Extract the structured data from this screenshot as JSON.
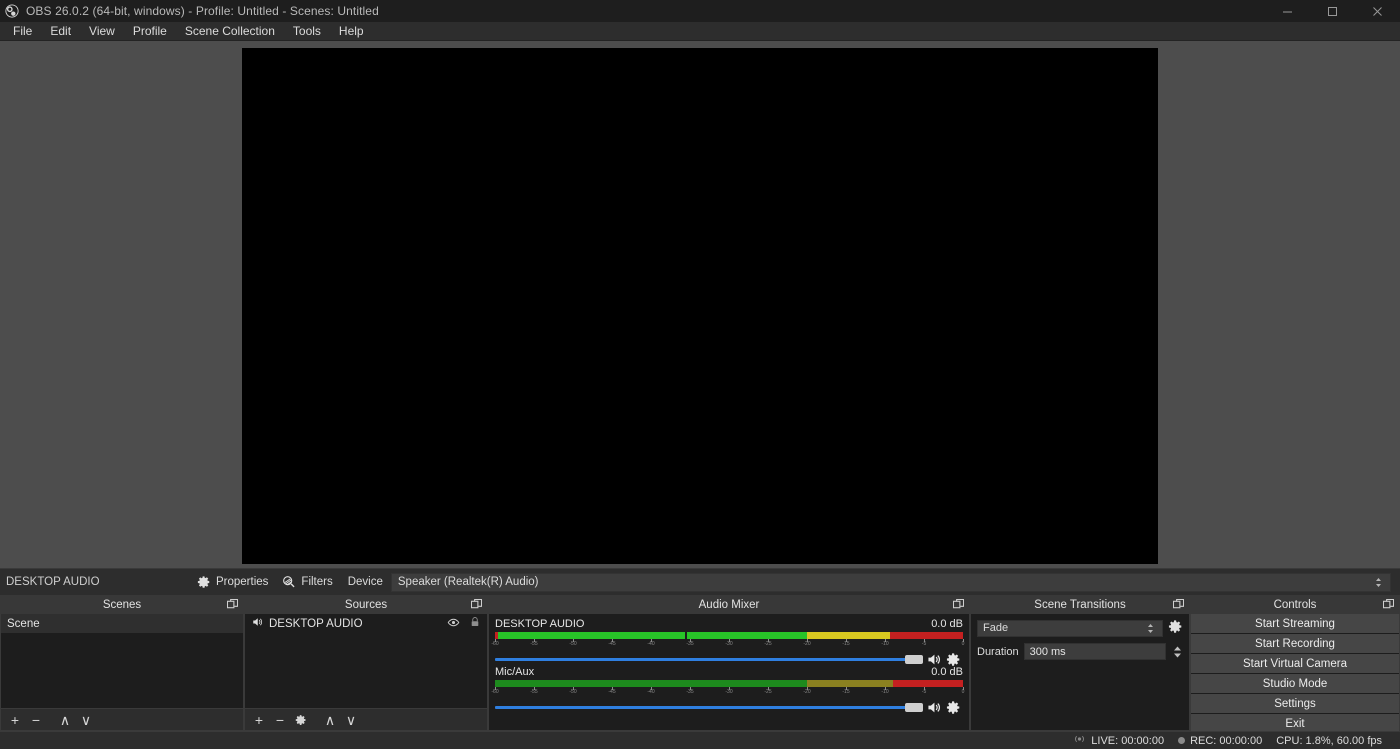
{
  "window": {
    "title": "OBS 26.0.2 (64-bit, windows) - Profile: Untitled - Scenes: Untitled",
    "minimize_label": "Minimize",
    "maximize_label": "Maximize",
    "close_label": "Close"
  },
  "menu": {
    "items": [
      {
        "label": "File"
      },
      {
        "label": "Edit"
      },
      {
        "label": "View"
      },
      {
        "label": "Profile"
      },
      {
        "label": "Scene Collection"
      },
      {
        "label": "Tools"
      },
      {
        "label": "Help"
      }
    ]
  },
  "source_toolbar": {
    "selected_source": "DESKTOP AUDIO",
    "properties_label": "Properties",
    "filters_label": "Filters",
    "device_label": "Device",
    "device_value": "Speaker (Realtek(R) Audio)"
  },
  "scenes": {
    "title": "Scenes",
    "items": [
      {
        "label": "Scene",
        "selected": true
      }
    ],
    "toolbar": [
      {
        "name": "add-scene-button",
        "glyph": "+"
      },
      {
        "name": "remove-scene-button",
        "glyph": "−"
      },
      {
        "name": "move-scene-up-button",
        "glyph": "∧"
      },
      {
        "name": "move-scene-down-button",
        "glyph": "∨"
      }
    ]
  },
  "sources": {
    "title": "Sources",
    "items": [
      {
        "label": "DESKTOP AUDIO",
        "icon": "speaker-icon",
        "visible": true,
        "locked": false
      }
    ],
    "toolbar": [
      {
        "name": "add-source-button",
        "glyph": "+"
      },
      {
        "name": "remove-source-button",
        "glyph": "−"
      },
      {
        "name": "source-properties-button",
        "glyph": "gear"
      },
      {
        "name": "move-source-up-button",
        "glyph": "∧"
      },
      {
        "name": "move-source-down-button",
        "glyph": "∨"
      }
    ]
  },
  "audio_mixer": {
    "title": "Audio Mixer",
    "scale_ticks": [
      -60,
      -55,
      -50,
      -45,
      -40,
      -35,
      -30,
      -25,
      -20,
      -15,
      -10,
      -5,
      0
    ],
    "channels": [
      {
        "name": "DESKTOP AUDIO",
        "db": "0.0 dB",
        "active": true,
        "level_percent": 100,
        "peak_percent": 40.5,
        "volume_percent": 100
      },
      {
        "name": "Mic/Aux",
        "db": "0.0 dB",
        "active": false,
        "level_percent": 100,
        "peak_percent": 0,
        "volume_percent": 100
      }
    ]
  },
  "scene_transitions": {
    "title": "Scene Transitions",
    "transition_value": "Fade",
    "duration_label": "Duration",
    "duration_value": "300 ms"
  },
  "controls": {
    "title": "Controls",
    "buttons": [
      {
        "label": "Start Streaming",
        "name": "start-streaming-button"
      },
      {
        "label": "Start Recording",
        "name": "start-recording-button"
      },
      {
        "label": "Start Virtual Camera",
        "name": "start-virtual-camera-button"
      },
      {
        "label": "Studio Mode",
        "name": "studio-mode-button"
      },
      {
        "label": "Settings",
        "name": "settings-button"
      },
      {
        "label": "Exit",
        "name": "exit-button"
      }
    ]
  },
  "status_bar": {
    "live": "LIVE: 00:00:00",
    "rec": "REC: 00:00:00",
    "cpu": "CPU: 1.8%, 60.00 fps"
  },
  "colors": {
    "meter_green": "#28c428",
    "meter_yellow": "#d8c820",
    "meter_yellow_dim": "#8a8020",
    "meter_red": "#c42020",
    "meter_green_dim": "#1d8a1d",
    "slider_blue": "#2f7fe0",
    "canvas": "#000000",
    "preview_bg": "#4d4d4d"
  }
}
